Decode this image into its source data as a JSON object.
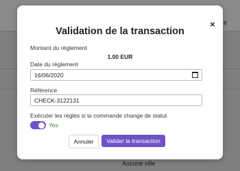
{
  "background": {
    "right_text": "e",
    "bottom_text": "Aucune ville"
  },
  "modal": {
    "title": "Validation de la transaction",
    "close_label": "×",
    "amount_label": "Montant du règlement",
    "amount_value": "1.00 EUR",
    "date_label": "Date du règlement",
    "date_value": "16/06/2020",
    "reference_label": "Référence",
    "reference_value": "CHECK-3122131",
    "rules_label": "Exécuter les règles si la commande change de statut",
    "toggle_state": "Yes",
    "cancel_label": "Annuler",
    "validate_label": "Valider la transaction"
  },
  "colors": {
    "accent": "#6f52c8",
    "success": "#2e8a2e"
  },
  "icons": {
    "close": "close-icon",
    "calendar": "calendar-icon"
  }
}
